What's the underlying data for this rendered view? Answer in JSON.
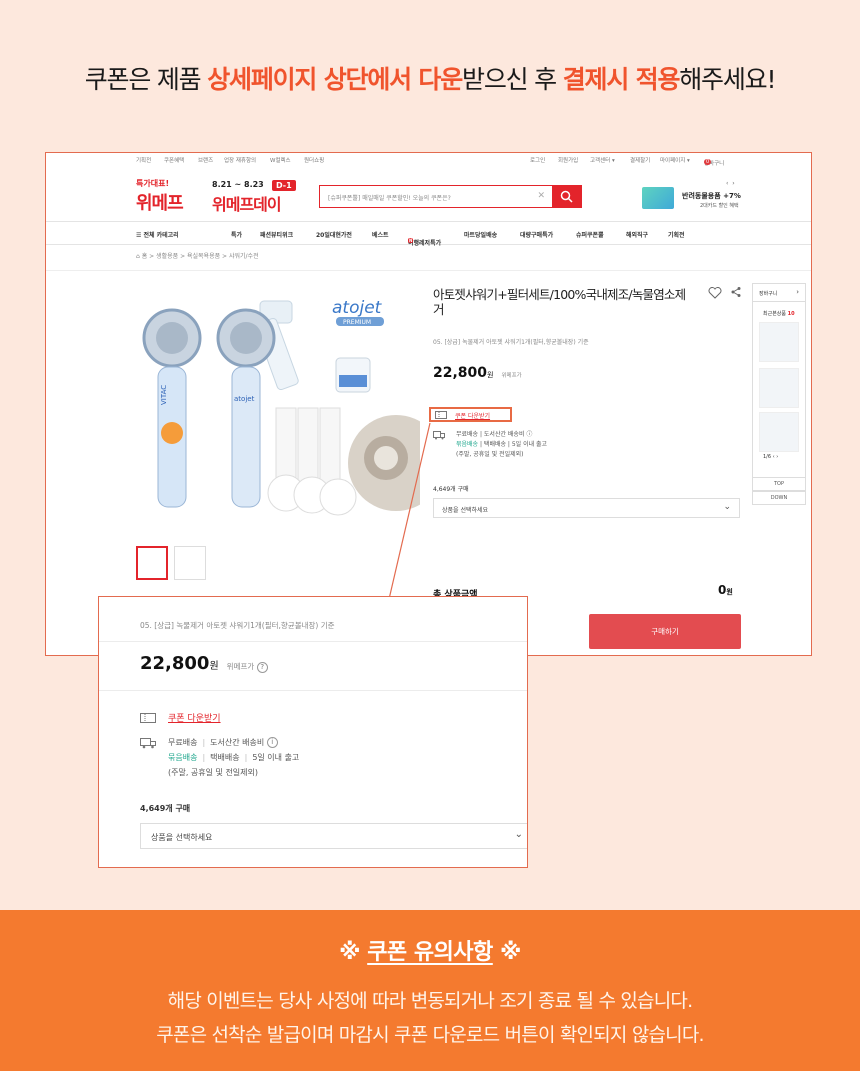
{
  "headline": {
    "p1": "쿠폰은 제품 ",
    "h1": "상세페이지 상단에서 다운",
    "p2": "받으신 후 ",
    "h2": "결제시 적용",
    "p3": "해주세요!"
  },
  "screenshot": {
    "util_left": [
      "기획전",
      "쿠폰혜택",
      "브랜즈",
      "업장 재휴항의",
      "W컬렉스",
      "원더쇼핑"
    ],
    "util_right": [
      "로그인",
      "회원가입",
      "고객센터 ▾",
      "결제찰기",
      "마이페이지 ▾",
      "장바구니"
    ],
    "cart_count": "0",
    "promo_label": "특가대표!",
    "logo": "위메프",
    "event_dates": "8.21 ~ 8.23",
    "dday": "D-1",
    "event_logo": "위메프데이",
    "search_placeholder": "[슈퍼쿠폰뿔] 매일매일 쿠폰할인! 오늘의 쿠폰은?",
    "ad_title": "반려동물용품 +7%",
    "ad_sub": "2대카드 할인 혜택",
    "ad_arrows": "‹ ›",
    "nav": [
      "☰  전체 카테고리",
      "특가",
      "패션뷰티위크",
      "20일대현가전",
      "베스트",
      "여행레저특가",
      "마트당일배송",
      "대량구매특가",
      "슈퍼쿠폰뿔",
      "해외직구",
      "기획전"
    ],
    "nav_new_badge": "N",
    "breadcrumb": "⌂ 홈  >  생활용품  >  욕실목욕용품  >  샤워기/수전",
    "product_title": "아토젯샤워기+필터세트/100%국내제조/녹물염소제거",
    "product_desc": "05. [상급] 녹물제거 아토젯 샤워기1개(필터,향균볼내장) 기준",
    "price": "22,800",
    "price_unit": "원",
    "price_compare": "위메프가",
    "coupon_link": "쿠폰 다운받기",
    "ship_line1": "무료배송 | 도서산간 배송비 ⓘ",
    "ship_line2_green": "묶음배송",
    "ship_line2_rest": " | 택배배송 | 5일 이내 출고",
    "ship_line3": "(주말, 공휴일 및 전일제외)",
    "buy_count": "4,649개 구매",
    "select_placeholder": "상품을 선택하세요",
    "total_label": "총 상품금액",
    "total_value": "0",
    "total_unit": "원",
    "buy_button": "구매하기",
    "side_cart": "장바구니",
    "side_recent_label": "최근본상품",
    "side_recent_count": "10",
    "side_pager": "1/6  ‹ ›",
    "side_top": "TOP",
    "side_down": "DOWN",
    "brand_atojet": "atojet",
    "brand_premium": "PREMIUM",
    "brand_vitac": "VITAC"
  },
  "zoom": {
    "desc": "05. [상급] 녹물제거 아토젯 샤워기1개(필터,향균볼내장) 기준",
    "price": "22,800",
    "price_unit": "원",
    "price_compare": "위메프가",
    "coupon_link": "쿠폰 다운받기",
    "ship_free": "무료배송",
    "ship_remote": "도서산간 배송비",
    "ship_bundle": "묶음배송",
    "ship_courier": "택배배송",
    "ship_days": "5일 이내 출고",
    "ship_note": "(주말, 공휴일 및 전일제외)",
    "buy_count": "4,649개 구매",
    "select_placeholder": "상품을 선택하세요"
  },
  "notice": {
    "title_prefix": "※ ",
    "title": "쿠폰 유의사항",
    "title_suffix": " ※",
    "line1": "해당 이벤트는 당사 사정에 따라 변동되거나 조기 종료 될 수 있습니다.",
    "line2": "쿠폰은 선착순 발급이며 마감시 쿠폰 다운로드 버튼이 확인되지 않습니다."
  },
  "colors": {
    "background": "#fde8dd",
    "accent": "#f0542d",
    "brand_red": "#e3242b",
    "notice_bg": "#f47a2f"
  }
}
